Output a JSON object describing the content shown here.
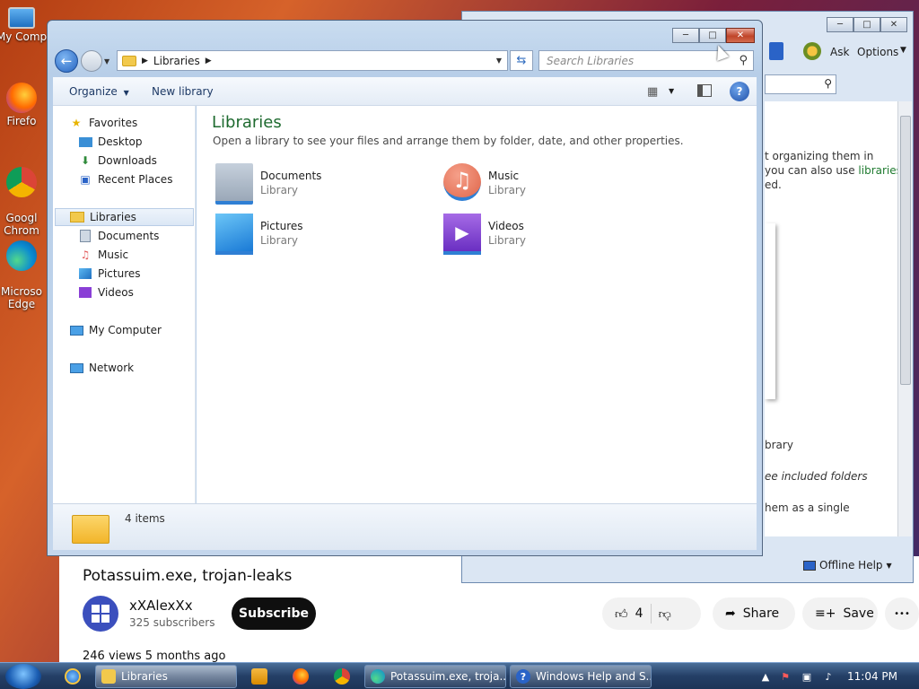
{
  "desktop": {
    "icons": [
      {
        "label": "My Comp"
      },
      {
        "label": "Firefo"
      },
      {
        "label": "Googl\nChrom"
      },
      {
        "label": "Microso\nEdge"
      }
    ]
  },
  "help_window": {
    "toolbar": {
      "ask": "Ask",
      "options": "Options"
    },
    "snippets": [
      "t organizing them in",
      "you can also use",
      "libraries",
      "ed.",
      "brary",
      "ee included folders",
      "hem as a single"
    ],
    "offline_help": "Offline Help"
  },
  "explorer": {
    "address": {
      "crumb": "Libraries"
    },
    "search_placeholder": "Search Libraries",
    "commands": {
      "organize": "Organize",
      "new_library": "New library"
    },
    "nav": {
      "favorites": "Favorites",
      "desktop": "Desktop",
      "downloads": "Downloads",
      "recent_places": "Recent Places",
      "libraries": "Libraries",
      "documents": "Documents",
      "music": "Music",
      "pictures": "Pictures",
      "videos": "Videos",
      "my_computer": "My Computer",
      "network": "Network"
    },
    "content": {
      "title": "Libraries",
      "subtitle": "Open a library to see your files and arrange them by folder, date, and other properties.",
      "libraries": [
        {
          "name": "Documents",
          "type": "Library"
        },
        {
          "name": "Music",
          "type": "Library"
        },
        {
          "name": "Pictures",
          "type": "Library"
        },
        {
          "name": "Videos",
          "type": "Library"
        }
      ]
    },
    "status": "4 items"
  },
  "video": {
    "title": "Potassuim.exe, trojan-leaks",
    "channel": "xXAlexXx",
    "subscribers": "325 subscribers",
    "subscribe": "Subscribe",
    "likes": "4",
    "share": "Share",
    "save": "Save",
    "more": "•••",
    "views": "246 views  5 months ago"
  },
  "taskbar": {
    "items": [
      {
        "label": "Libraries"
      },
      {
        "label": "Potassuim.exe, troja..."
      },
      {
        "label": "Windows Help and S..."
      }
    ],
    "clock": "11:04 PM"
  }
}
